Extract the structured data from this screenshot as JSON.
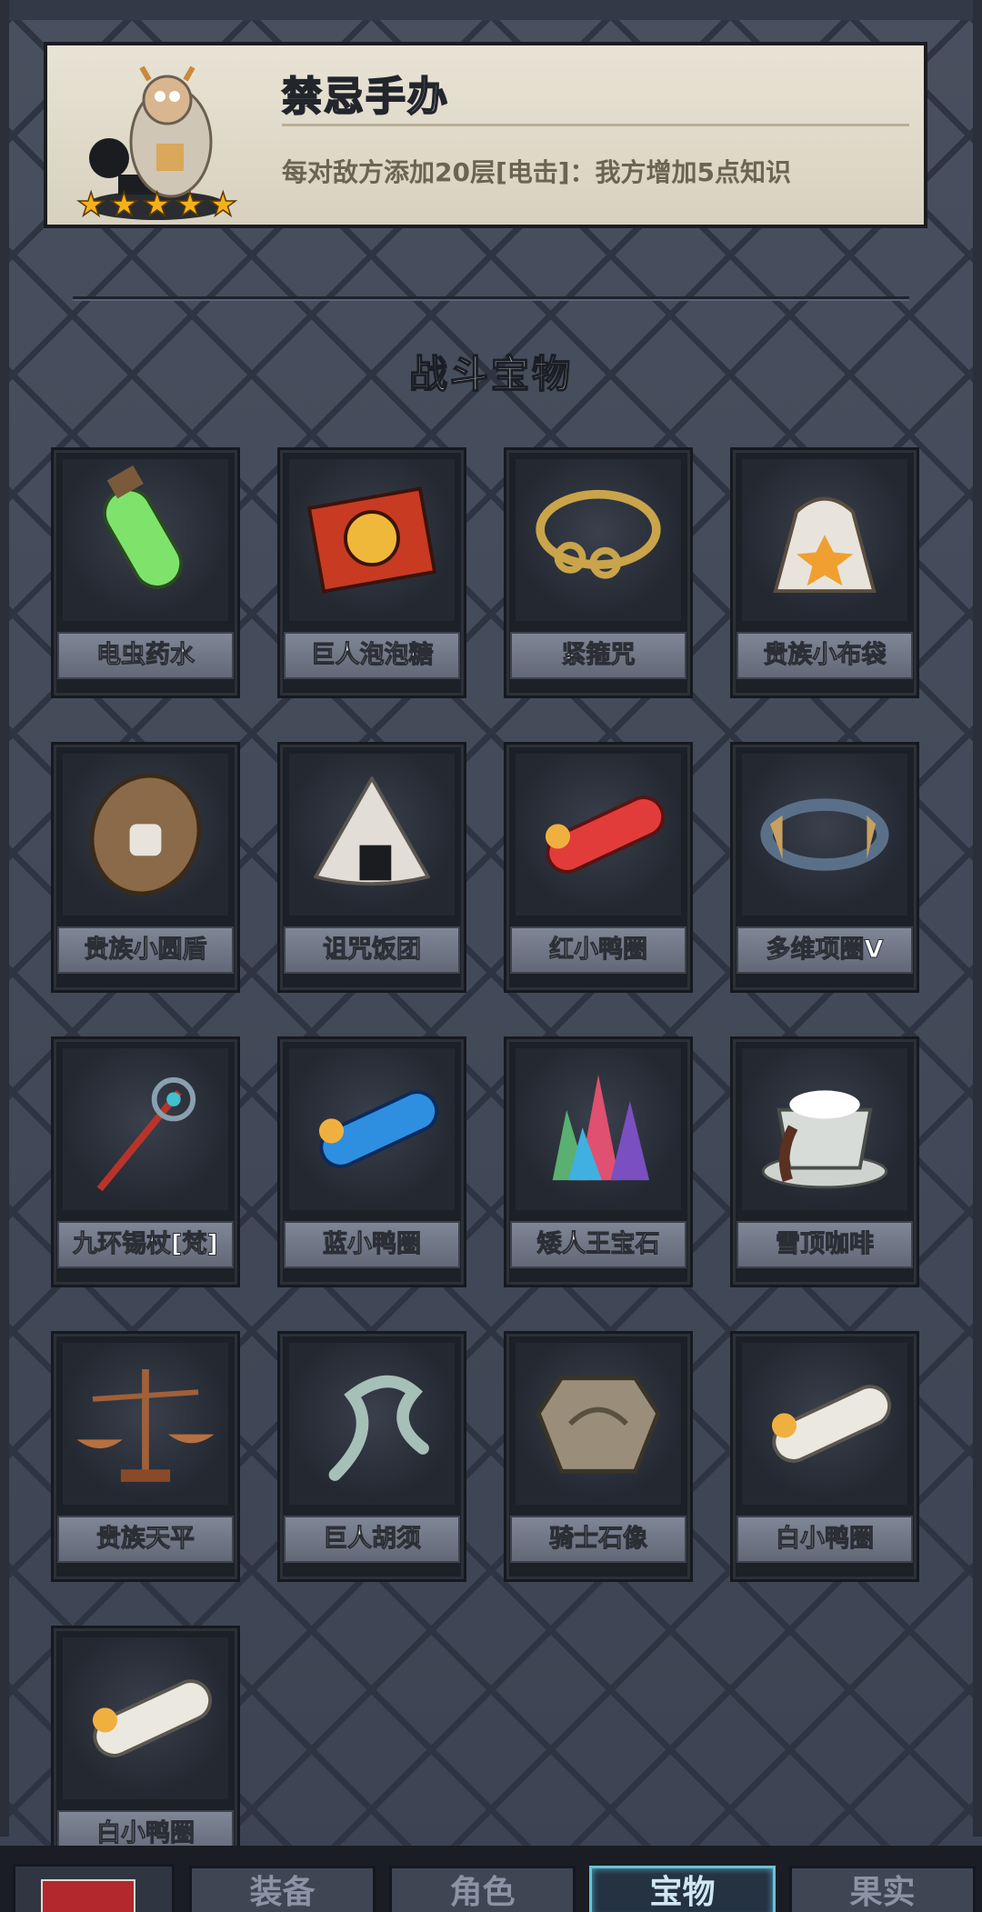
{
  "detail": {
    "title": "禁忌手办",
    "description": "每对敌方添加20层[电击]：我方增加5点知识",
    "rating": 5
  },
  "section_title": "战斗宝物",
  "items": [
    {
      "name": "电虫药水",
      "icon": "potion-icon"
    },
    {
      "name": "巨人泡泡糖",
      "icon": "gum-box-icon"
    },
    {
      "name": "紧箍咒",
      "icon": "golden-band-icon"
    },
    {
      "name": "贵族小布袋",
      "icon": "cloth-bag-icon"
    },
    {
      "name": "贵族小圆盾",
      "icon": "round-shield-icon"
    },
    {
      "name": "诅咒饭团",
      "icon": "rice-ball-icon"
    },
    {
      "name": "红小鸭圈",
      "icon": "red-duck-ring-icon"
    },
    {
      "name": "多维项圈V",
      "icon": "collar-icon"
    },
    {
      "name": "九环锡杖[梵]",
      "icon": "staff-icon"
    },
    {
      "name": "蓝小鸭圈",
      "icon": "blue-duck-ring-icon"
    },
    {
      "name": "矮人王宝石",
      "icon": "crystal-icon"
    },
    {
      "name": "雪顶咖啡",
      "icon": "coffee-cup-icon"
    },
    {
      "name": "贵族天平",
      "icon": "balance-scale-icon"
    },
    {
      "name": "巨人胡须",
      "icon": "beard-icon"
    },
    {
      "name": "骑士石像",
      "icon": "stone-plaque-icon"
    },
    {
      "name": "白小鸭圈",
      "icon": "white-duck-ring-icon"
    },
    {
      "name": "白小鸭圈",
      "icon": "white-duck-ring-icon"
    }
  ],
  "tabs": [
    {
      "label": "装备"
    },
    {
      "label": "角色"
    },
    {
      "label": "宝物",
      "active": true
    },
    {
      "label": "果实"
    }
  ],
  "colors": {
    "star": "#f5b11c",
    "active_tab": "#6bc1d8"
  }
}
